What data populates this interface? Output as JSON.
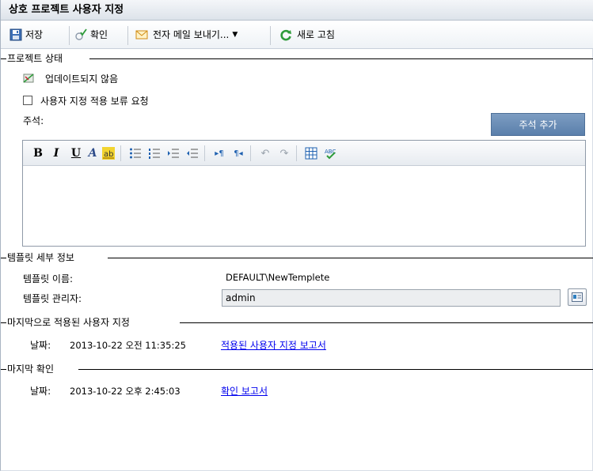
{
  "window": {
    "title": "상호 프로젝트 사용자 지정"
  },
  "toolbar": {
    "save_label": "저장",
    "check_label": "확인",
    "email_label": "전자 메일 보내기...",
    "refresh_label": "새로 고침"
  },
  "project_status": {
    "section_title": "프로젝트 상태",
    "status_text": "업데이트되지 않음",
    "pending_checkbox_label": "사용자 지정 적용 보류 요청",
    "pending_checked": false,
    "note_label": "주석:",
    "add_note_button": "주석 추가",
    "editor_tools": [
      "bold-icon",
      "italic-icon",
      "underline-icon",
      "font-color-icon",
      "highlight-icon",
      "bulleted-list-icon",
      "numbered-list-icon",
      "indent-icon",
      "outdent-icon",
      "ltr-icon",
      "rtl-icon",
      "undo-icon",
      "redo-icon",
      "table-icon",
      "spellcheck-icon"
    ]
  },
  "template_details": {
    "section_title": "템플릿 세부 정보",
    "name_label": "템플릿 이름:",
    "name_value": "DEFAULT\\NewTemplete",
    "admin_label": "템플릿 관리자:",
    "admin_value": "admin"
  },
  "last_applied": {
    "section_title": "마지막으로 적용된 사용자 지정",
    "date_label": "날짜:",
    "date_value": "2013-10-22 오전 11:35:25",
    "report_link": "적용된 사용자 지정 보고서"
  },
  "last_check": {
    "section_title": "마지막 확인",
    "date_label": "날짜:",
    "date_value": "2013-10-22 오후 2:45:03",
    "report_link": "확인 보고서"
  },
  "colors": {
    "accent_button": "#5a7fab",
    "link": "#0000ee",
    "refresh_green": "#2e9b3a",
    "email_orange": "#e0a020"
  }
}
